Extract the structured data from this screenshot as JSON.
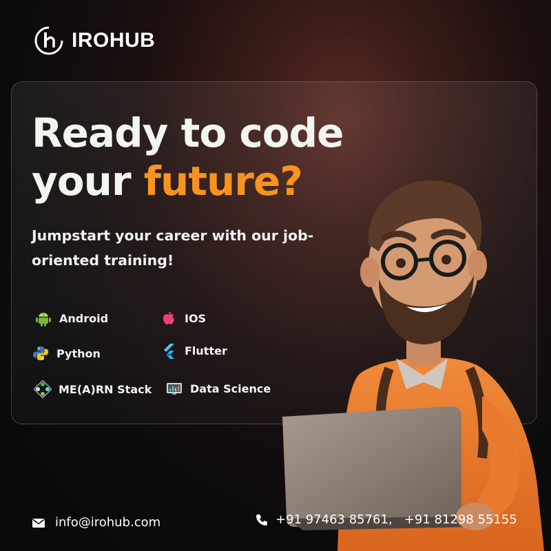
{
  "brand": {
    "name": "IROHUB"
  },
  "hero": {
    "line1": "Ready to code",
    "line2_prefix": "your ",
    "line2_accent": "future?",
    "subtitle": "Jumpstart your career with our job-oriented training!"
  },
  "courses": [
    {
      "label": "Android",
      "icon": "android-icon"
    },
    {
      "label": "IOS",
      "icon": "apple-icon"
    },
    {
      "label": "Python",
      "icon": "python-icon"
    },
    {
      "label": "Flutter",
      "icon": "flutter-icon"
    },
    {
      "label": "ME(A)RN Stack",
      "icon": "mern-icon"
    },
    {
      "label": "Data Science",
      "icon": "data-science-icon"
    }
  ],
  "contact": {
    "email": "info@irohub.com",
    "phones": "+91 97463 85761,   +91 81298 55155"
  },
  "colors": {
    "accent": "#f7931e",
    "headline": "#f2f6ee",
    "background": "#0b0b0c"
  }
}
